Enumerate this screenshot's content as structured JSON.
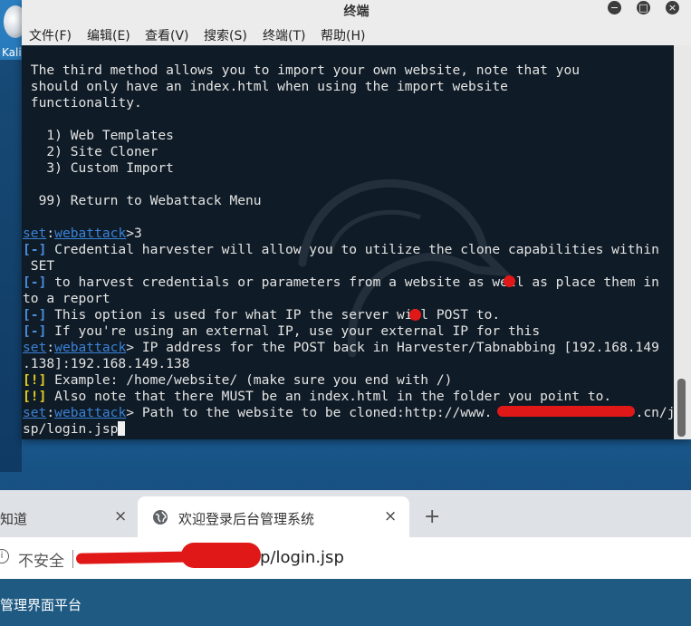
{
  "desktop": {
    "icon_label": "Kali Live"
  },
  "terminal": {
    "title": "终端",
    "window_buttons": [
      "−",
      "□",
      "×"
    ],
    "menu": [
      "文件(F)",
      "编辑(E)",
      "查看(V)",
      "搜索(S)",
      "终端(T)",
      "帮助(H)"
    ],
    "lines": {
      "l1": " The third method allows you to import your own website, note that you",
      "l2": " should only have an index.html when using the import website",
      "l3": " functionality.",
      "l4": "   1) Web Templates",
      "l5": "   2) Site Cloner",
      "l6": "   3) Custom Import",
      "l7": "  99) Return to Webattack Menu",
      "prompt_set": "set",
      "prompt_colon": ":",
      "prompt_module": "webattack",
      "prompt_gt": ">",
      "l8_input": "3",
      "info_tag": "[-]",
      "warn_tag": "[!]",
      "l9": " Credential harvester will allow you to utilize the clone capabilities within",
      "l10": " SET",
      "l11": " to harvest credentials or parameters from a website as well as place them in",
      "l12": "to a report",
      "l13": " This option is used for what IP the server will POST to.",
      "l14": " If you're using an external IP, use your external IP for this",
      "l15": " IP address for the POST back in Harvester/Tabnabbing [192.168.149",
      "l16": ".138]:192.168.149.138",
      "l17": " Example: /home/website/ (make sure you end with /)",
      "l18": " Also note that there MUST be an index.html in the folder you point to.",
      "l19": " Path to the website to be cloned:http://www.                  .cn/j",
      "l20": "sp/login.jsp"
    }
  },
  "browser": {
    "tab1_label": "知道",
    "tab2_label": "欢迎登录后台管理系统",
    "close_glyph": "×",
    "new_tab_glyph": "+",
    "info_glyph": "i",
    "insecure_label": "不安全",
    "url_tail": "p/login.jsp",
    "page_header": "管理界面平台"
  },
  "colors": {
    "prompt_blue": "#3a82d8",
    "warn_yellow": "#e3d026",
    "redaction_red": "#e01818",
    "terminal_bg": "#0f1b26"
  }
}
